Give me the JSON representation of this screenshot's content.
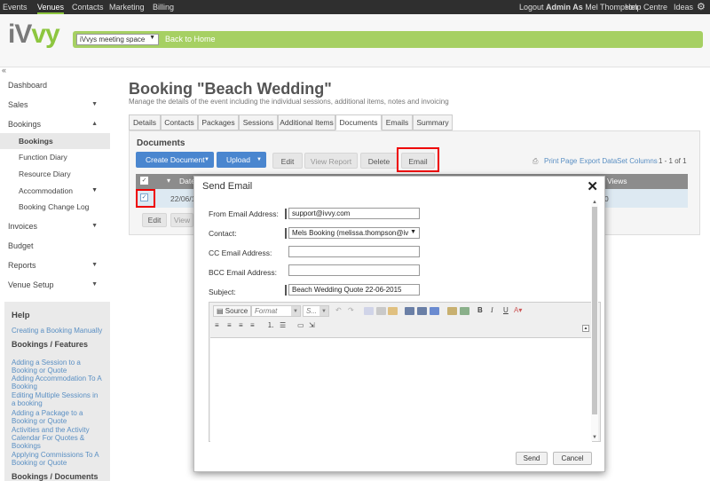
{
  "topbar": {
    "nav": [
      "Events",
      "Venues",
      "Contacts",
      "Marketing",
      "Billing"
    ],
    "logout_prefix": "Logout ",
    "logout_bold": "Admin As",
    "logout_user": " Mel Thompson",
    "help_centre": "Help Centre",
    "ideas": "Ideas"
  },
  "header": {
    "logo_main": "iV",
    "logo_accent": "vy",
    "venue_select": "iVvys meeting space",
    "back_home": "Back to Home"
  },
  "sidebar": {
    "items": [
      {
        "label": "Dashboard"
      },
      {
        "label": "Sales"
      },
      {
        "label": "Bookings"
      },
      {
        "label": "Invoices"
      },
      {
        "label": "Budget"
      },
      {
        "label": "Reports"
      },
      {
        "label": "Venue Setup"
      }
    ],
    "booking_subs": [
      "Bookings",
      "Function Diary",
      "Resource Diary",
      "Accommodation",
      "Booking Change Log"
    ],
    "help": {
      "title": "Help",
      "link_manual": "Creating a Booking Manually",
      "section_features": "Bookings / Features",
      "links": [
        "Adding a Session to a Booking or Quote",
        "Adding Accommodation To A Booking",
        "Editing Multiple Sessions in a booking",
        "Adding a Package to a Booking or Quote",
        "Activities and the Activity Calendar For Quotes & Bookings",
        "Applying Commissions To A Booking or Quote"
      ],
      "section_documents": "Bookings / Documents"
    }
  },
  "page": {
    "title": "Booking \"Beach Wedding\"",
    "subtitle": "Manage the details of the event including the individual sessions, additional items, notes and invoicing",
    "tabs": [
      "Details",
      "Contacts",
      "Packages",
      "Sessions",
      "Additional Items",
      "Documents",
      "Emails",
      "Summary"
    ],
    "active_tab": "Documents"
  },
  "documents": {
    "heading": "Documents",
    "create_document": "Create Document",
    "upload": "Upload",
    "edit": "Edit",
    "view_report": "View Report",
    "delete": "Delete",
    "email": "Email",
    "print_page": "Print Page",
    "export_data": "Export Data",
    "set_columns": "Set Columns",
    "paging": "1 - 1 of 1",
    "col_date": "Date",
    "col_views": "Views",
    "row_date": "22/06/15",
    "row_extra": "0",
    "below_edit": "Edit",
    "below_view": "View"
  },
  "modal": {
    "title": "Send Email",
    "from_label": "From Email Address:",
    "from_value": "support@ivvy.com",
    "contact_label": "Contact:",
    "contact_value": "Mels Booking (melissa.thompson@iv",
    "cc_label": "CC Email Address:",
    "cc_value": "",
    "bcc_label": "BCC Email Address:",
    "bcc_value": "",
    "subject_label": "Subject:",
    "subject_value": "Beach Wedding Quote 22-06-2015",
    "toolbar": {
      "source": "Source",
      "format": "Format",
      "style": "S...",
      "bold": "B",
      "italic": "I",
      "underline": "U"
    },
    "send": "Send",
    "cancel": "Cancel"
  },
  "colors": {
    "accent_green": "#a6d063",
    "button_blue": "#4a86cf",
    "highlight_red": "#ee0000"
  }
}
